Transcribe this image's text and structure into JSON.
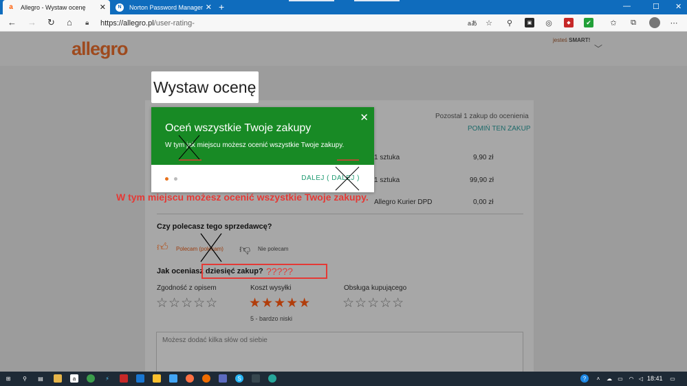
{
  "browser": {
    "tabs": [
      {
        "title": "Allegro - Wystaw ocenę",
        "favicon": "a"
      },
      {
        "title": "Norton Password Manager - Ska",
        "favicon": "N"
      }
    ],
    "new_tab": "+",
    "url_host": "https://allegro.pl",
    "url_path": "/user-rating-",
    "window_controls": {
      "minimize": "—",
      "maximize": "☐",
      "close": "✕"
    }
  },
  "site": {
    "logo": "allegro",
    "smart_prefix": "jesteś",
    "smart_brand": "SMART!"
  },
  "page": {
    "title": "Wystaw ocenę",
    "remaining": "Pozostał 1 zakup do ocenienia",
    "skip": "POMIŃ TEN ZAKUP",
    "summary": [
      {
        "label": "1 sztuka",
        "price": "9,90 zł"
      },
      {
        "label": "1 sztuka",
        "price": "99,90 zł"
      },
      {
        "label": "Allegro Kurier DPD",
        "price": "0,00 zł"
      }
    ],
    "recommend_question": "Czy polecasz tego sprzedawcę?",
    "recommend_yes": "Polecam (polecam)",
    "recommend_no": "Nie polecam",
    "rating_question": "Jak oceniasz dziesięć zakup?",
    "rating_marks": "?????",
    "criteria": [
      {
        "label": "Zgodność z opisem",
        "stars": 0
      },
      {
        "label": "Koszt wysyłki",
        "stars": 5,
        "caption": "5 - bardzo niski"
      },
      {
        "label": "Obsługa kupującego",
        "stars": 0
      }
    ],
    "comment_placeholder": "Możesz dodać kilka słów od siebie"
  },
  "modal": {
    "title": "Oceń wszystkie Twoje zakupy",
    "subtitle": "W tym jak miejscu możesz ocenić wszystkie Twoje zakupy.",
    "next": "DALEJ ( DALEJ )",
    "close": "✕"
  },
  "annotation": {
    "red_text": "W tym miejscu możesz ocenić wszystkie Twoje zakupy."
  },
  "taskbar": {
    "time": "18:41"
  },
  "colors": {
    "modal_green": "#188a25",
    "accent_orange": "#ff5a00",
    "annotation_red": "#e53935"
  }
}
